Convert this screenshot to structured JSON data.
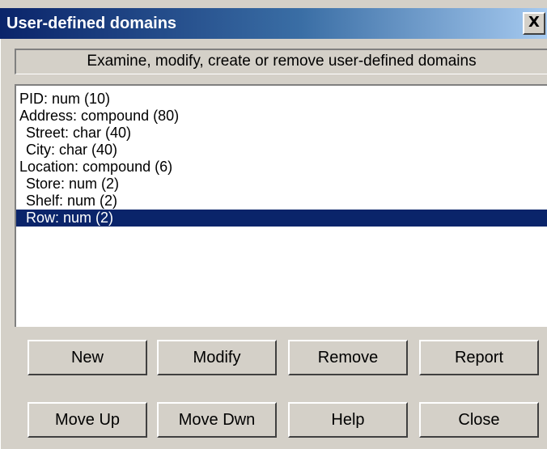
{
  "window": {
    "title": "User-defined domains",
    "close_label": "X"
  },
  "info": {
    "text": "Examine, modify, create or remove user-defined domains"
  },
  "domains": {
    "items": [
      {
        "label": "PID: num (10)",
        "indent": false,
        "selected": false
      },
      {
        "label": "Address: compound (80)",
        "indent": false,
        "selected": false
      },
      {
        "label": "Street: char (40)",
        "indent": true,
        "selected": false
      },
      {
        "label": "City: char (40)",
        "indent": true,
        "selected": false
      },
      {
        "label": "Location: compound (6)",
        "indent": false,
        "selected": false
      },
      {
        "label": "Store: num (2)",
        "indent": true,
        "selected": false
      },
      {
        "label": "Shelf: num (2)",
        "indent": true,
        "selected": false
      },
      {
        "label": "Row: num (2)",
        "indent": true,
        "selected": true
      }
    ]
  },
  "buttons": {
    "new": "New",
    "modify": "Modify",
    "remove": "Remove",
    "report": "Report",
    "move_up": "Move Up",
    "move_down": "Move Dwn",
    "help": "Help",
    "close": "Close"
  },
  "colors": {
    "title_bar": "#0a246a",
    "selection": "#0a246a",
    "face": "#d4d0c8"
  }
}
